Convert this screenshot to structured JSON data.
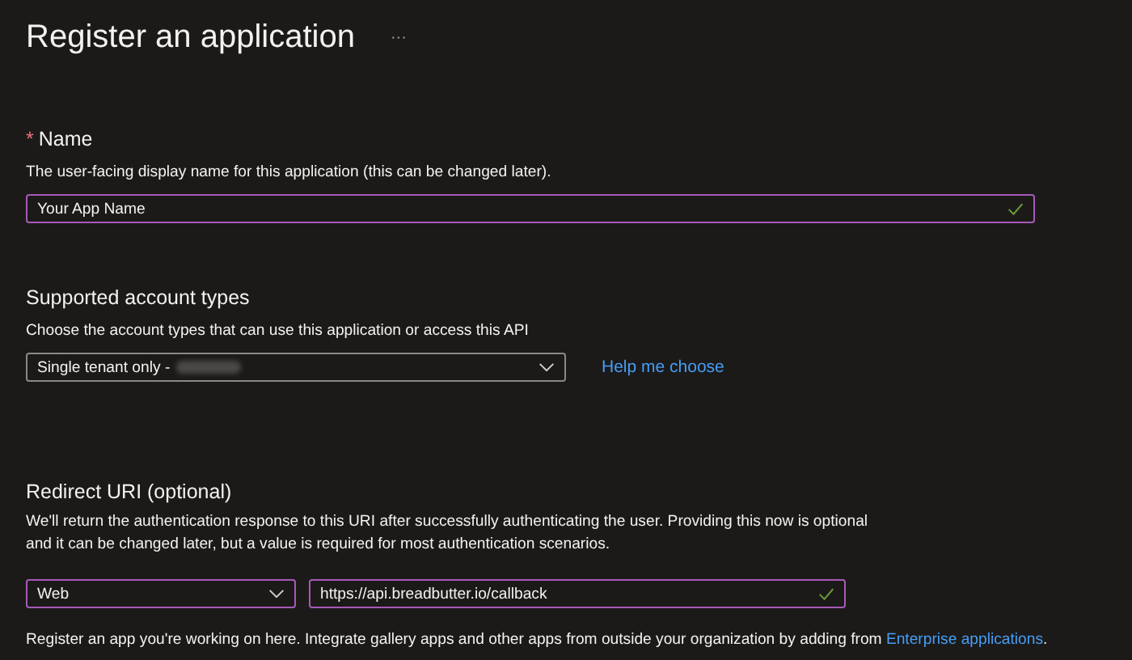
{
  "page": {
    "title": "Register an application",
    "more": "···"
  },
  "name_section": {
    "label": "Name",
    "required_mark": "*",
    "description": "The user-facing display name for this application (this can be changed later).",
    "field": {
      "value": "Your App Name",
      "focused": true,
      "valid": true
    }
  },
  "account_types": {
    "heading": "Supported account types",
    "description": "Choose the account types that can use this application or access this API",
    "dropdown": {
      "value": "Single tenant only -",
      "redacted": true,
      "focused": false
    },
    "help_link": "Help me choose"
  },
  "redirect_uri": {
    "heading": "Redirect URI (optional)",
    "description": "We'll return the authentication response to this URI after successfully authenticating the user. Providing this now is optional and it can be changed later, but a value is required for most authentication scenarios.",
    "platform_dropdown": {
      "value": "Web",
      "focused": true
    },
    "uri_field": {
      "value": "https://api.breadbutter.io/callback",
      "focused": true,
      "valid": true
    }
  },
  "footer": {
    "text_before": "Register an app you're working on here. Integrate gallery apps and other apps from outside your organization by adding from ",
    "link": "Enterprise applications",
    "text_after": "."
  }
}
